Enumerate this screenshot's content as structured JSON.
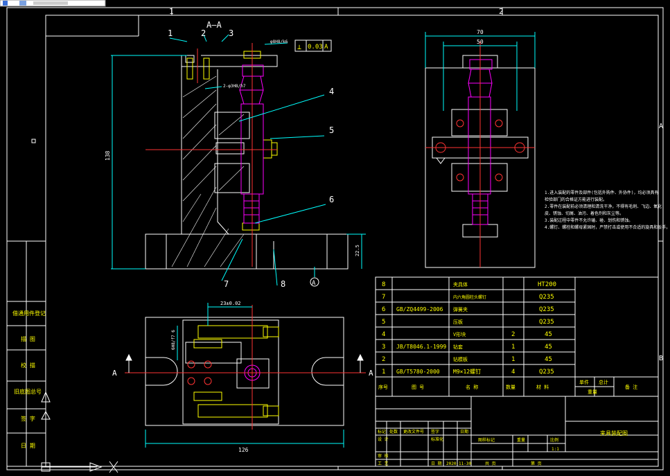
{
  "app": {
    "tab_label": "",
    "icon": "drawing-file-icon"
  },
  "colors": {
    "bg": "#000000",
    "frame": "#ffffff",
    "cyan": "#00ffff",
    "red": "#ff3333",
    "magenta": "#ff00ff",
    "yellow": "#ffff00",
    "green": "#00ff00"
  },
  "grid": {
    "col1": "1",
    "col2": "2",
    "row_a": "A",
    "row_b": "B"
  },
  "view_labels": {
    "section": "A—A",
    "leaders": [
      "1",
      "2",
      "3",
      "4",
      "5",
      "6",
      "7",
      "8"
    ],
    "section_marks": [
      "A",
      "A"
    ],
    "datum": "A"
  },
  "dimensions": {
    "fit_top": "φ8H8/k6",
    "fit_left": "2-φ3H8/h7",
    "height": "138",
    "small_v": "22.5",
    "width_top": "70",
    "width_inner": "50",
    "plan_width": "126",
    "plan_top": "23±0.02",
    "plan_vert": "6H8/f7 6"
  },
  "tolerance": {
    "symbol": "⊥",
    "value": "0.03",
    "datum": "A"
  },
  "notes": [
    "1.进入装配的零件及部件(包括外购件、外协件)，均必须具有",
    "检验部门的合格证方能进行装配。",
    "2.零件在装配前必须清理和清洗干净，不得有毛刺、飞边、氧化",
    "皮、锈蚀、切屑、油污、着色剂和灰尘等。",
    "3.装配过程中零件不允许磕、碰、划伤和锈蚀。",
    "4.螺钉、螺栓和螺母紧固时，严禁打击或使用不合适的旋具和扳手。"
  ],
  "bom": {
    "rows": [
      {
        "no": "8",
        "code": "",
        "name": "夹具体",
        "qty": "",
        "material": "HT200"
      },
      {
        "no": "7",
        "code": "",
        "name": "内六角圆柱头螺钉",
        "qty": "",
        "material": "Q235"
      },
      {
        "no": "6",
        "code": "GB/ZQ4499-2006",
        "name": "弹簧夹",
        "qty": "",
        "material": "Q235"
      },
      {
        "no": "5",
        "code": "",
        "name": "压板",
        "qty": "",
        "material": "Q235"
      },
      {
        "no": "4",
        "code": "",
        "name": "V形块",
        "qty": "2",
        "material": "45"
      },
      {
        "no": "3",
        "code": "JB/T8046.1-1999",
        "name": "钻套",
        "qty": "1",
        "material": "45"
      },
      {
        "no": "2",
        "code": "",
        "name": "钻模板",
        "qty": "1",
        "material": "45"
      },
      {
        "no": "1",
        "code": "GB/T5780-2000",
        "name": "M9×12螺钉",
        "qty": "4",
        "material": "Q235"
      }
    ],
    "header": {
      "no": "序号",
      "code": "图  号",
      "name": "名  称",
      "qty": "数量",
      "material": "材  料",
      "single": "单件",
      "total": "总计",
      "weight": "重量",
      "remark": "备  注"
    }
  },
  "title_block": {
    "drawing_name": "夹具装配图",
    "row1": [
      "标记",
      "处数",
      "更改文件号",
      "签字",
      "日期"
    ],
    "designer": "设 计",
    "std": "标准化",
    "stage": "图样标记",
    "weight": "重量",
    "scale": "比例",
    "scale_value": "1:1",
    "review": "审 核",
    "craft": "工 艺",
    "date_label": "日 期",
    "date": "2020-11-30",
    "sheets": "共  页",
    "sheet": "第  页"
  },
  "side_table": [
    "借通用件登记",
    "描 图",
    "校 描",
    "旧底图总号",
    "签 字",
    "日 期"
  ]
}
